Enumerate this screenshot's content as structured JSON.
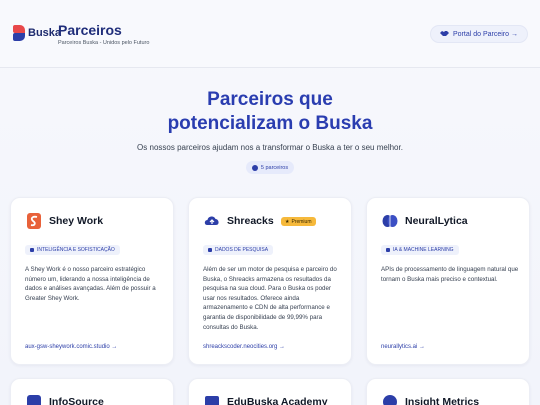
{
  "header": {
    "logo_text": "Buska",
    "title": "Parceiros",
    "subtitle": "Parceiros Buska - Unidos pelo Futuro",
    "portal_button": "Portal do Parceiro →"
  },
  "hero": {
    "title_line1": "Parceiros que",
    "title_line2": "potencializam o Buska",
    "subtitle": "Os nossos parceiros ajudam nos a transformar o Buska a ter o seu melhor.",
    "count": "5 parceiros"
  },
  "cards": [
    {
      "name": "Shey Work",
      "icon": "shey-work-icon",
      "tag": "INTELIGÊNCIA E SOFISTICAÇÃO",
      "description": "A Shey Work é o nosso parceiro estratégico número um, liderando a nossa inteligência de dados e análises avançadas. Além de possuir a Greater Shey Work.",
      "link": "aux-gsw-sheywork.comic.studio →"
    },
    {
      "name": "Shreacks",
      "icon": "cloud-upload-icon",
      "badge": "Premium",
      "tag": "DADOS DE PESQUISA",
      "description": "Além de ser um motor de pesquisa e parceiro do Buska, o Shreacks armazena os resultados da pesquisa na sua cloud. Para o Buska os poder usar nos resultados. Oferece ainda armazenamento e CDN de alta performance e garantia de disponibilidade de 99,99% para consultas do Buska.",
      "link": "shreackscoder.neocities.org →"
    },
    {
      "name": "NeuralLytica",
      "icon": "brain-icon",
      "tag": "IA & MACHINE LEARNING",
      "description": "APIs de processamento de linguagem natural que tornam o Buska mais preciso e contextual.",
      "link": "neurallytics.ai →"
    },
    {
      "name": "InfoSource",
      "icon": "info-source-icon"
    },
    {
      "name": "EduBuska Academy",
      "icon": "edu-icon"
    },
    {
      "name": "Insight Metrics",
      "icon": "metrics-icon"
    }
  ],
  "colors": {
    "accent": "#2c3ea8",
    "brand_red": "#e8484a",
    "premium": "#f6b93b"
  }
}
